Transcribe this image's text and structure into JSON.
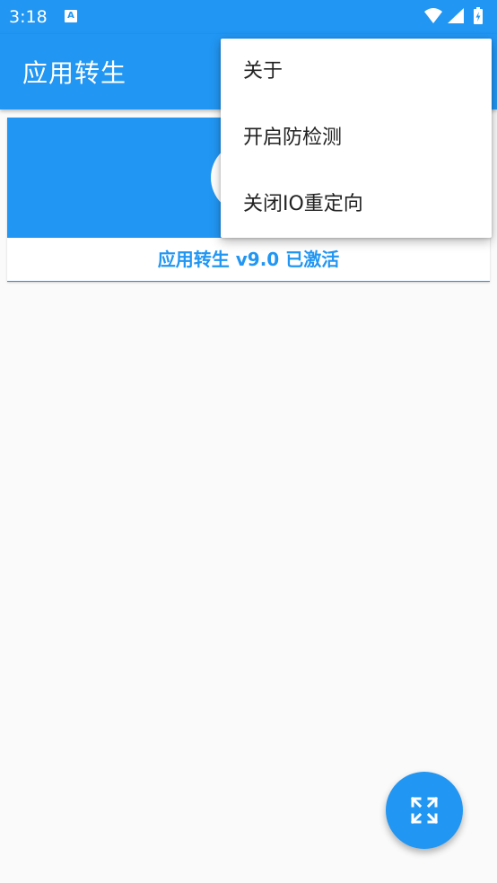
{
  "status_bar": {
    "time": "3:18",
    "notification_icon": "a-notification-icon",
    "icons": [
      "wifi-icon",
      "signal-icon",
      "battery-charging-icon"
    ]
  },
  "app_bar": {
    "title": "应用转生"
  },
  "card": {
    "status_text": "应用转生 v9.0 已激活"
  },
  "menu": {
    "items": [
      "关于",
      "开启防检测",
      "关闭IO重定向"
    ]
  },
  "fab": {
    "icon": "expand-arrows-icon"
  },
  "colors": {
    "primary": "#2196f3",
    "background": "#fafafa",
    "menu_text": "#212121"
  }
}
